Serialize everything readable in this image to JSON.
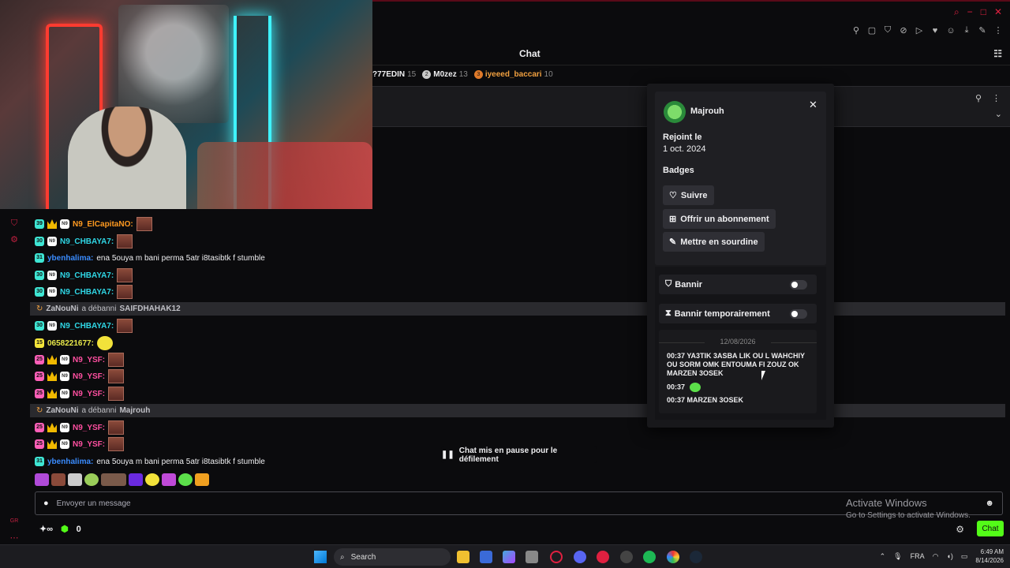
{
  "window": {
    "controls": [
      "−",
      "□",
      "✕"
    ]
  },
  "header": {
    "title": "Chat"
  },
  "leaderboard": [
    {
      "name": "?77EDIN",
      "count": "15",
      "rank": ""
    },
    {
      "name": "M0zez",
      "count": "13",
      "rank": "2"
    },
    {
      "name": "iyeeed_baccari",
      "count": "10",
      "rank": "3"
    }
  ],
  "messages": [
    {
      "user": "N9_ElCapitaNO:",
      "badge": "39",
      "color": "orange"
    },
    {
      "user": "N9_CHBAYA7:",
      "badge": "30",
      "color": "teal"
    },
    {
      "user": "ybenhalima:",
      "badge": "31",
      "color": "blue",
      "text": "ena 5ouya m bani perma 5atr i8tasibtk f stumble"
    },
    {
      "user": "N9_CHBAYA7:",
      "badge": "30",
      "color": "teal"
    },
    {
      "user": "N9_CHBAYA7:",
      "badge": "30",
      "color": "teal"
    },
    {
      "user": "N9_CHBAYA7:",
      "badge": "30",
      "color": "teal"
    },
    {
      "user": "0658221677:",
      "badge": "15",
      "color": "yellow"
    },
    {
      "user": "N9_YSF:",
      "badge": "25",
      "color": "pink"
    },
    {
      "user": "N9_YSF:",
      "badge": "25",
      "color": "pink"
    },
    {
      "user": "N9_YSF:",
      "badge": "25",
      "color": "pink"
    },
    {
      "user": "N9_YSF:",
      "badge": "25",
      "color": "pink"
    },
    {
      "user": "N9_YSF:",
      "badge": "25",
      "color": "pink"
    },
    {
      "user": "ybenhalima:",
      "badge": "31",
      "color": "blue",
      "text": "ena 5ouya m bani perma 5atr i8tasibtk f stumble"
    }
  ],
  "system_events": [
    {
      "actor": "ZaNouNi",
      "action": "a débanni",
      "target": "SAIFDHAHAK12"
    },
    {
      "actor": "ZaNouNi",
      "action": "a débanni",
      "target": "Majrouh"
    }
  ],
  "pause_notice": "Chat mis en pause pour le défilement",
  "user_card": {
    "username": "Majrouh",
    "joined_label": "Rejoint le",
    "joined_date": "1 oct. 2024",
    "badges_label": "Badges",
    "follow": "Suivre",
    "gift_sub": "Offrir un abonnement",
    "mute": "Mettre en sourdine",
    "ban": "Bannir",
    "timeout": "Bannir temporairement",
    "history_date": "12/08/2026",
    "history": [
      {
        "time": "00:37",
        "text": "YA3TIK 3ASBA LIK OU L WAHCHIY OU SORM OMK ENTOUMA FI ZOUZ OK MARZEN 3OSEK"
      },
      {
        "time": "00:37",
        "text": ""
      },
      {
        "time": "00:37",
        "text": "MARZEN 3OSEK"
      }
    ]
  },
  "input": {
    "placeholder": "Envoyer un message"
  },
  "bottom": {
    "points": "0",
    "chat_button": "Chat"
  },
  "watermark": {
    "line1": "Activate Windows",
    "line2": "Go to Settings to activate Windows."
  },
  "taskbar": {
    "search": "Search",
    "lang": "FRA",
    "time": "6:49 AM",
    "date": "8/14/2026"
  },
  "colors": {
    "kick_green": "#53fc18",
    "accent_red": "#e02040"
  }
}
